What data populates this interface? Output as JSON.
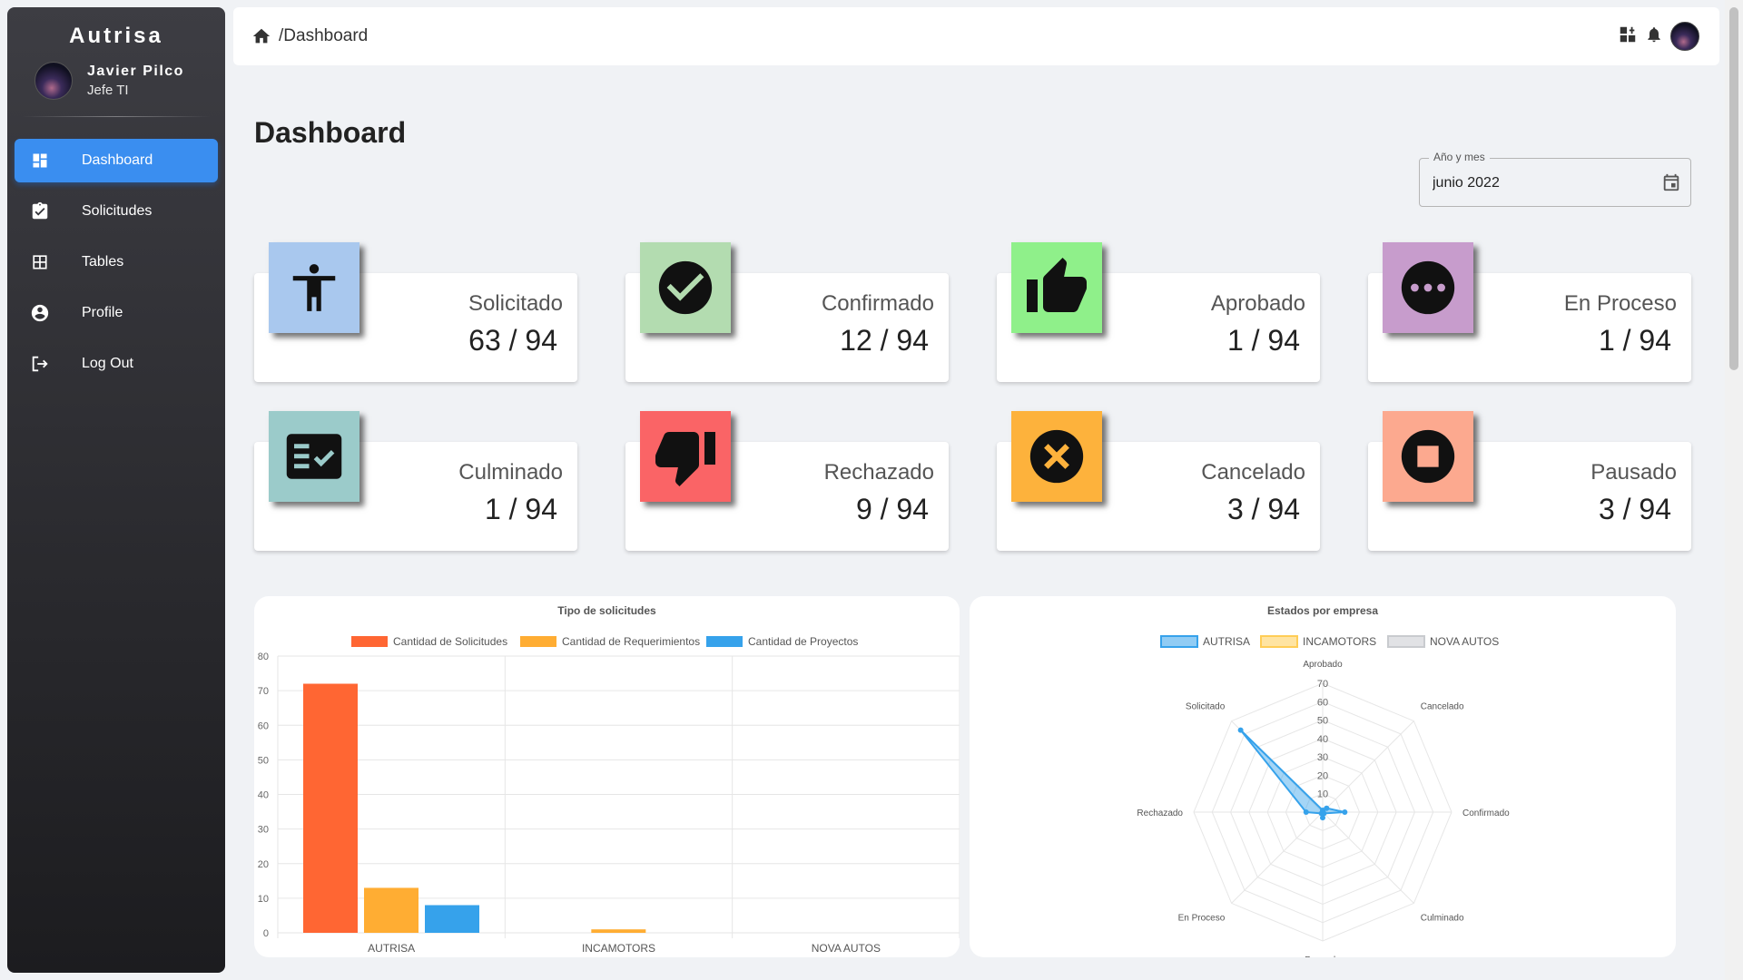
{
  "sidebar": {
    "brand": "Autrisa",
    "user": {
      "name": "Javier Pilco",
      "role": "Jefe TI"
    },
    "items": [
      {
        "label": "Dashboard",
        "icon": "dashboard-icon",
        "active": true
      },
      {
        "label": "Solicitudes",
        "icon": "assignment-turned-in-icon"
      },
      {
        "label": "Tables",
        "icon": "table-icon"
      },
      {
        "label": "Profile",
        "icon": "account-circle-icon"
      },
      {
        "label": "Log Out",
        "icon": "logout-icon"
      }
    ]
  },
  "topbar": {
    "breadcrumb": "/Dashboard"
  },
  "page": {
    "title": "Dashboard"
  },
  "date_filter": {
    "label": "Año y mes",
    "value": "junio 2022"
  },
  "cards": [
    {
      "label": "Solicitado",
      "value": "63 / 94",
      "color": "#a9c8ee",
      "icon": "accessibility-icon"
    },
    {
      "label": "Confirmado",
      "value": "12 / 94",
      "color": "#b3dcb0",
      "icon": "check-circle-icon"
    },
    {
      "label": "Aprobado",
      "value": "1 / 94",
      "color": "#8ff08a",
      "icon": "thumb-up-icon"
    },
    {
      "label": "En Proceso",
      "value": "1 / 94",
      "color": "#c79ccc",
      "icon": "more-horiz-icon"
    },
    {
      "label": "Culminado",
      "value": "1 / 94",
      "color": "#9bcbca",
      "icon": "fact-check-icon"
    },
    {
      "label": "Rechazado",
      "value": "9 / 94",
      "color": "#fa6466",
      "icon": "thumb-down-icon"
    },
    {
      "label": "Cancelado",
      "value": "3 / 94",
      "color": "#fdb23c",
      "icon": "cancel-icon"
    },
    {
      "label": "Pausado",
      "value": "3 / 94",
      "color": "#fca98f",
      "icon": "stop-circle-icon"
    }
  ],
  "chart_data": [
    {
      "type": "bar",
      "title": "Tipo de solicitudes",
      "categories": [
        "AUTRISA",
        "INCAMOTORS",
        "NOVA AUTOS"
      ],
      "series": [
        {
          "name": "Cantidad de Solicitudes",
          "values": [
            72,
            0,
            0
          ],
          "color": "#ff6633"
        },
        {
          "name": "Cantidad de Requerimientos",
          "values": [
            13,
            1,
            0
          ],
          "color": "#ffad33"
        },
        {
          "name": "Cantidad de Proyectos",
          "values": [
            8,
            0,
            0
          ],
          "color": "#36a2eb"
        }
      ],
      "ylim": [
        0,
        80
      ],
      "yticks": [
        0,
        10,
        20,
        30,
        40,
        50,
        60,
        70,
        80
      ],
      "legend": "top",
      "grid": true
    },
    {
      "type": "radar",
      "title": "Estados por empresa",
      "axes": [
        "Aprobado",
        "Cancelado",
        "Confirmado",
        "Culminado",
        "Pausado",
        "En Proceso",
        "Rechazado",
        "Solicitado"
      ],
      "series": [
        {
          "name": "AUTRISA",
          "values": [
            1,
            3,
            12,
            1,
            3,
            1,
            9,
            63
          ],
          "color": "#36a2eb"
        },
        {
          "name": "INCAMOTORS",
          "values": [
            0,
            0,
            0,
            0,
            0,
            0,
            0,
            0
          ],
          "color": "#ffcd56"
        },
        {
          "name": "NOVA AUTOS",
          "values": [
            0,
            0,
            0,
            0,
            0,
            0,
            0,
            0
          ],
          "color": "#c9cbcf"
        }
      ],
      "rlim": [
        0,
        70
      ],
      "rticks": [
        10,
        20,
        30,
        40,
        50,
        60,
        70
      ],
      "legend": "top"
    }
  ]
}
